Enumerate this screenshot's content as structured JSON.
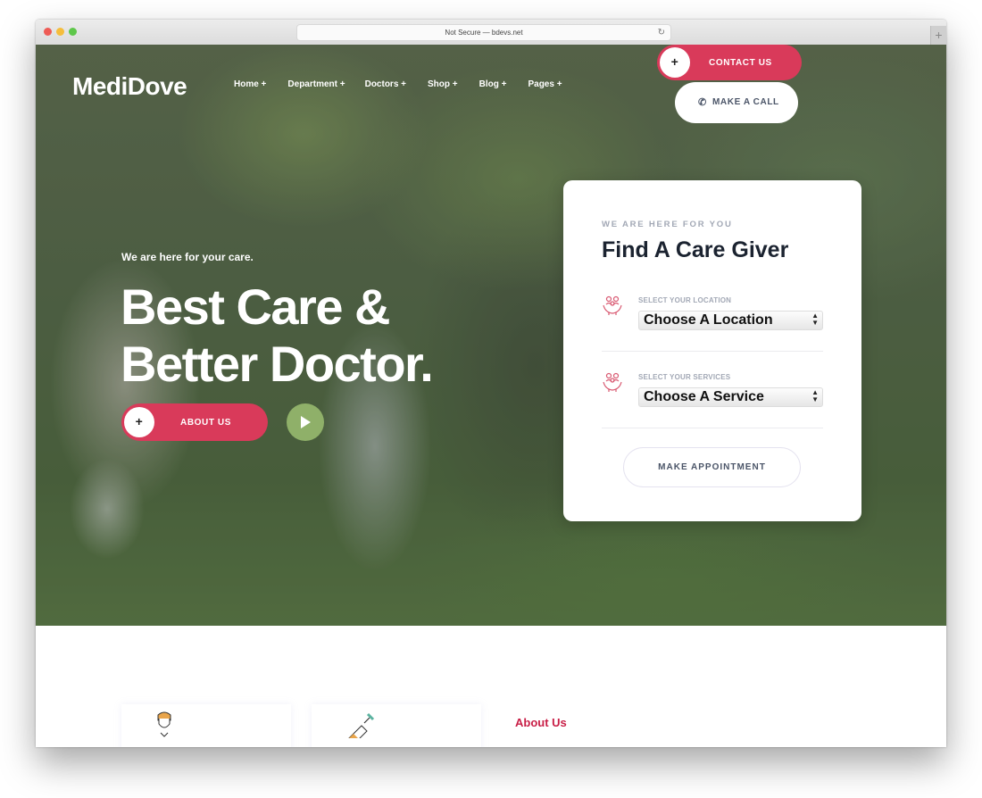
{
  "browser": {
    "url_text": "Not Secure — bdevs.net",
    "reload_icon": "↻",
    "new_tab_icon": "+"
  },
  "header": {
    "logo": "MediDove",
    "nav": [
      {
        "label": "Home +"
      },
      {
        "label": "Department +"
      },
      {
        "label": "Doctors +"
      },
      {
        "label": "Shop +"
      },
      {
        "label": "Blog +"
      },
      {
        "label": "Pages +"
      }
    ],
    "contact_button": {
      "icon": "+",
      "label": "CONTACT US"
    },
    "call_button": {
      "icon": "✆",
      "label": "MAKE A CALL"
    }
  },
  "hero": {
    "tagline": "We are here for your care.",
    "headline_line1": "Best Care &",
    "headline_line2": "Better Doctor.",
    "about_button": {
      "icon": "+",
      "label": "ABOUT US"
    },
    "play_button_icon": "play"
  },
  "care_card": {
    "subtitle": "WE ARE HERE FOR YOU",
    "title": "Find A Care Giver",
    "fields": [
      {
        "label": "SELECT YOUR LOCATION",
        "value": "Choose A Location",
        "icon": "family-care-icon"
      },
      {
        "label": "SELECT YOUR SERVICES",
        "value": "Choose A Service",
        "icon": "family-care-icon"
      }
    ],
    "submit_label": "MAKE APPOINTMENT"
  },
  "below": {
    "about_label": "About Us"
  },
  "colors": {
    "accent": "#d93a5a",
    "play": "#8fb069",
    "heading": "#1b2330",
    "muted": "#a2a8b5"
  }
}
